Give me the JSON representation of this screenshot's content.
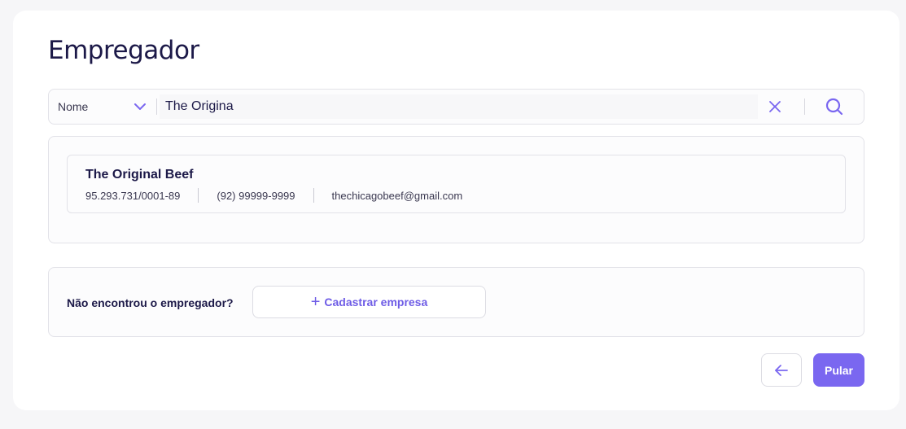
{
  "page": {
    "title": "Empregador"
  },
  "search": {
    "filter_label": "Nome",
    "query": "The Origina",
    "icons": {
      "filter": "chevron-down-icon",
      "clear": "close-icon",
      "search": "search-icon"
    }
  },
  "results": [
    {
      "name": "The Original Beef",
      "document": "95.293.731/0001-89",
      "phone": "(92) 99999-9999",
      "email": "thechicagobeef@gmail.com"
    }
  ],
  "not_found": {
    "label": "Não encontrou o empregador?",
    "register_label": "Cadastrar empresa",
    "register_icon": "plus-icon"
  },
  "footer": {
    "back_icon": "arrow-left-icon",
    "skip_label": "Pular"
  },
  "colors": {
    "accent": "#7a67f0",
    "title": "#1c1948"
  }
}
